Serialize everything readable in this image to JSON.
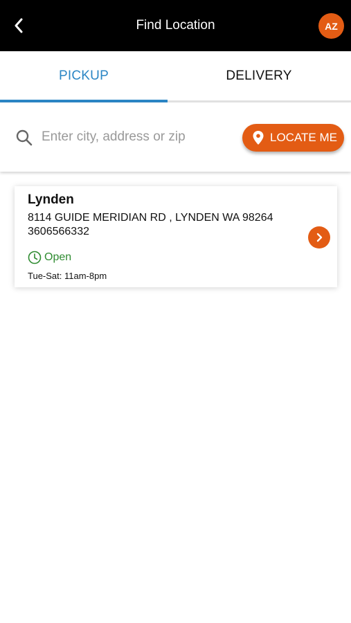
{
  "header": {
    "title": "Find Location",
    "avatar_initials": "AZ",
    "back_icon": "chevron-left-icon"
  },
  "tabs": [
    {
      "label": "PICKUP",
      "active": true
    },
    {
      "label": "DELIVERY",
      "active": false
    }
  ],
  "search": {
    "placeholder": "Enter city, address or zip",
    "value": "",
    "locate_label": "LOCATE ME"
  },
  "locations": [
    {
      "name": "Lynden",
      "address": "8114 GUIDE MERIDIAN RD , LYNDEN WA 98264",
      "phone": "3606566332",
      "status": "Open",
      "hours": "Tue-Sat: 11am-8pm"
    }
  ],
  "colors": {
    "accent": "#e35c14",
    "tab_active": "#2b86c5",
    "open_status": "#2e8b30",
    "header_bg": "#000000"
  }
}
